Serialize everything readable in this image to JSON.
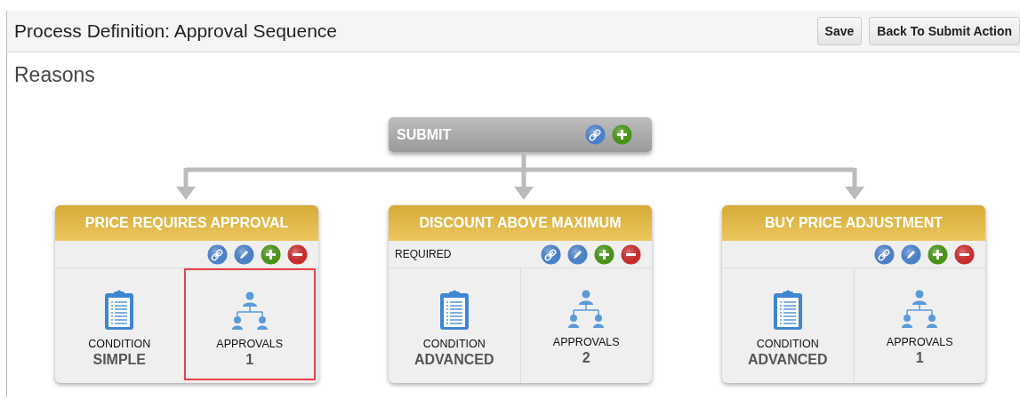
{
  "header": {
    "title": "Process Definition: Approval Sequence",
    "buttons": [
      "Save",
      "Back To Submit Action"
    ]
  },
  "section_title": "Reasons",
  "root": {
    "label": "SUBMIT",
    "actions": [
      {
        "kind": "link"
      },
      {
        "kind": "add"
      }
    ]
  },
  "cards": [
    {
      "title": "PRICE REQUIRES APPROVAL",
      "actions": [
        {
          "kind": "link"
        },
        {
          "kind": "edit"
        },
        {
          "kind": "add"
        },
        {
          "kind": "remove"
        }
      ],
      "condition": {
        "label": "CONDITION",
        "value": "SIMPLE"
      },
      "approvals": {
        "label": "APPROVALS",
        "value": "1",
        "selected": true
      }
    },
    {
      "title": "DISCOUNT ABOVE MAXIMUM",
      "badge": "REQUIRED",
      "actions": [
        {
          "kind": "link"
        },
        {
          "kind": "edit"
        },
        {
          "kind": "add"
        },
        {
          "kind": "remove"
        }
      ],
      "condition": {
        "label": "CONDITION",
        "value": "ADVANCED"
      },
      "approvals": {
        "label": "APPROVALS",
        "value": "2",
        "selected": false
      }
    },
    {
      "title": "BUY PRICE ADJUSTMENT",
      "actions": [
        {
          "kind": "link"
        },
        {
          "kind": "edit"
        },
        {
          "kind": "add"
        },
        {
          "kind": "remove"
        }
      ],
      "condition": {
        "label": "CONDITION",
        "value": "ADVANCED"
      },
      "approvals": {
        "label": "APPROVALS",
        "value": "1",
        "selected": false
      }
    }
  ]
}
